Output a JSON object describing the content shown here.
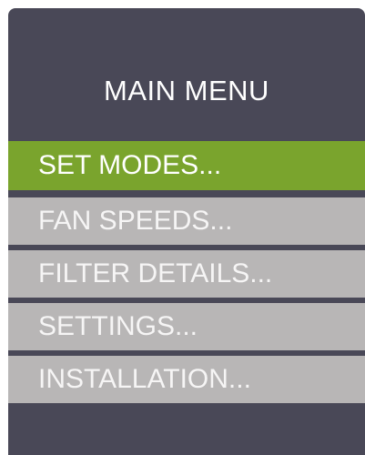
{
  "colors": {
    "panel_background": "#494857",
    "selected_item": "#7aa42d",
    "unselected_item": "#b8b6b6"
  },
  "menu": {
    "title": "MAIN MENU",
    "items": [
      {
        "label": "SET MODES...",
        "selected": true
      },
      {
        "label": "FAN SPEEDS...",
        "selected": false
      },
      {
        "label": "FILTER DETAILS...",
        "selected": false
      },
      {
        "label": "SETTINGS...",
        "selected": false
      },
      {
        "label": "INSTALLATION...",
        "selected": false
      }
    ]
  }
}
